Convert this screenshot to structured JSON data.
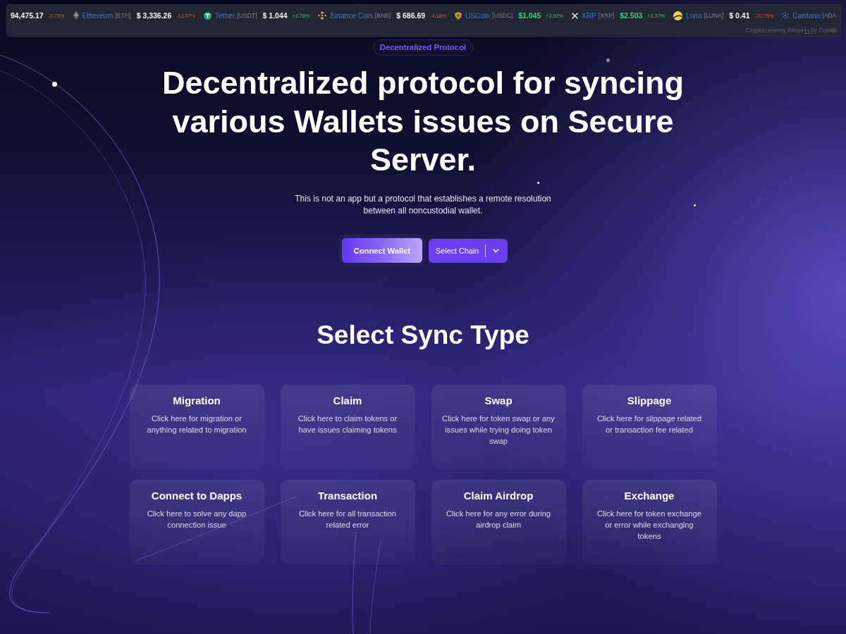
{
  "ticker": {
    "coins": [
      {
        "price": "94,475.17",
        "change": "-5.73%",
        "rising": false,
        "price_highlighted": false
      },
      {
        "name": "Ethereum",
        "symbol": "[ETH]",
        "price": "$ 3,336.26",
        "change": "-13.57%",
        "rising": false,
        "price_highlighted": false
      },
      {
        "name": "Tether",
        "symbol": "[USDT]",
        "price": "$ 1.044",
        "change": "+3.78%",
        "rising": true,
        "price_highlighted": false
      },
      {
        "name": "Binance Coin",
        "symbol": "[BNB]",
        "price": "$ 686.69",
        "change": "-4.18%",
        "rising": false,
        "price_highlighted": false
      },
      {
        "name": "USCoin",
        "symbol": "[USDC]",
        "price": "$1.045",
        "change": "+3.92%",
        "rising": true,
        "price_highlighted": true
      },
      {
        "name": "XRP",
        "symbol": "[XRP]",
        "price": "$2.503",
        "change": "+3.37%",
        "rising": true,
        "price_highlighted": true
      },
      {
        "name": "Luna",
        "symbol": "[LUNA]",
        "price": "$ 0.41",
        "change": "-20.75%",
        "rising": false,
        "price_highlighted": false
      },
      {
        "name": "Cardano",
        "symbol": "[ADA"
      }
    ],
    "credit_text": "Cryptocurrency Prices",
    "credit_link": "by Coinlib"
  },
  "hero": {
    "badge": "Decentralized Protocol",
    "title": "Decentralized protocol for syncing various Wallets issues on Secure Server.",
    "subtitle": "This is not an app but a protocol that establishes a remote resolution between all noncustodial wallet.",
    "connect_button": "Connect Wallet",
    "chain_button": "Select Chain"
  },
  "sync_section": {
    "heading": "Select Sync Type",
    "cards": [
      {
        "title": "Migration",
        "description": "Click here for migration or anything related to migration"
      },
      {
        "title": "Claim",
        "description": "Click here to claim tokens or have issues claiming tokens"
      },
      {
        "title": "Swap",
        "description": "Click here for token swap or any issues while trying doing token swap"
      },
      {
        "title": "Slippage",
        "description": "Click here for slippage related or transaction fee related"
      },
      {
        "title": "Connect to Dapps",
        "description": "Click here to solve any dapp connection issue"
      },
      {
        "title": "Transaction",
        "description": "Click here for all transaction related error"
      },
      {
        "title": "Claim Airdrop",
        "description": "Click here for any error during airdrop claim"
      },
      {
        "title": "Exchange",
        "description": "Click here for token exchange or error while exchanging tokens"
      }
    ]
  }
}
